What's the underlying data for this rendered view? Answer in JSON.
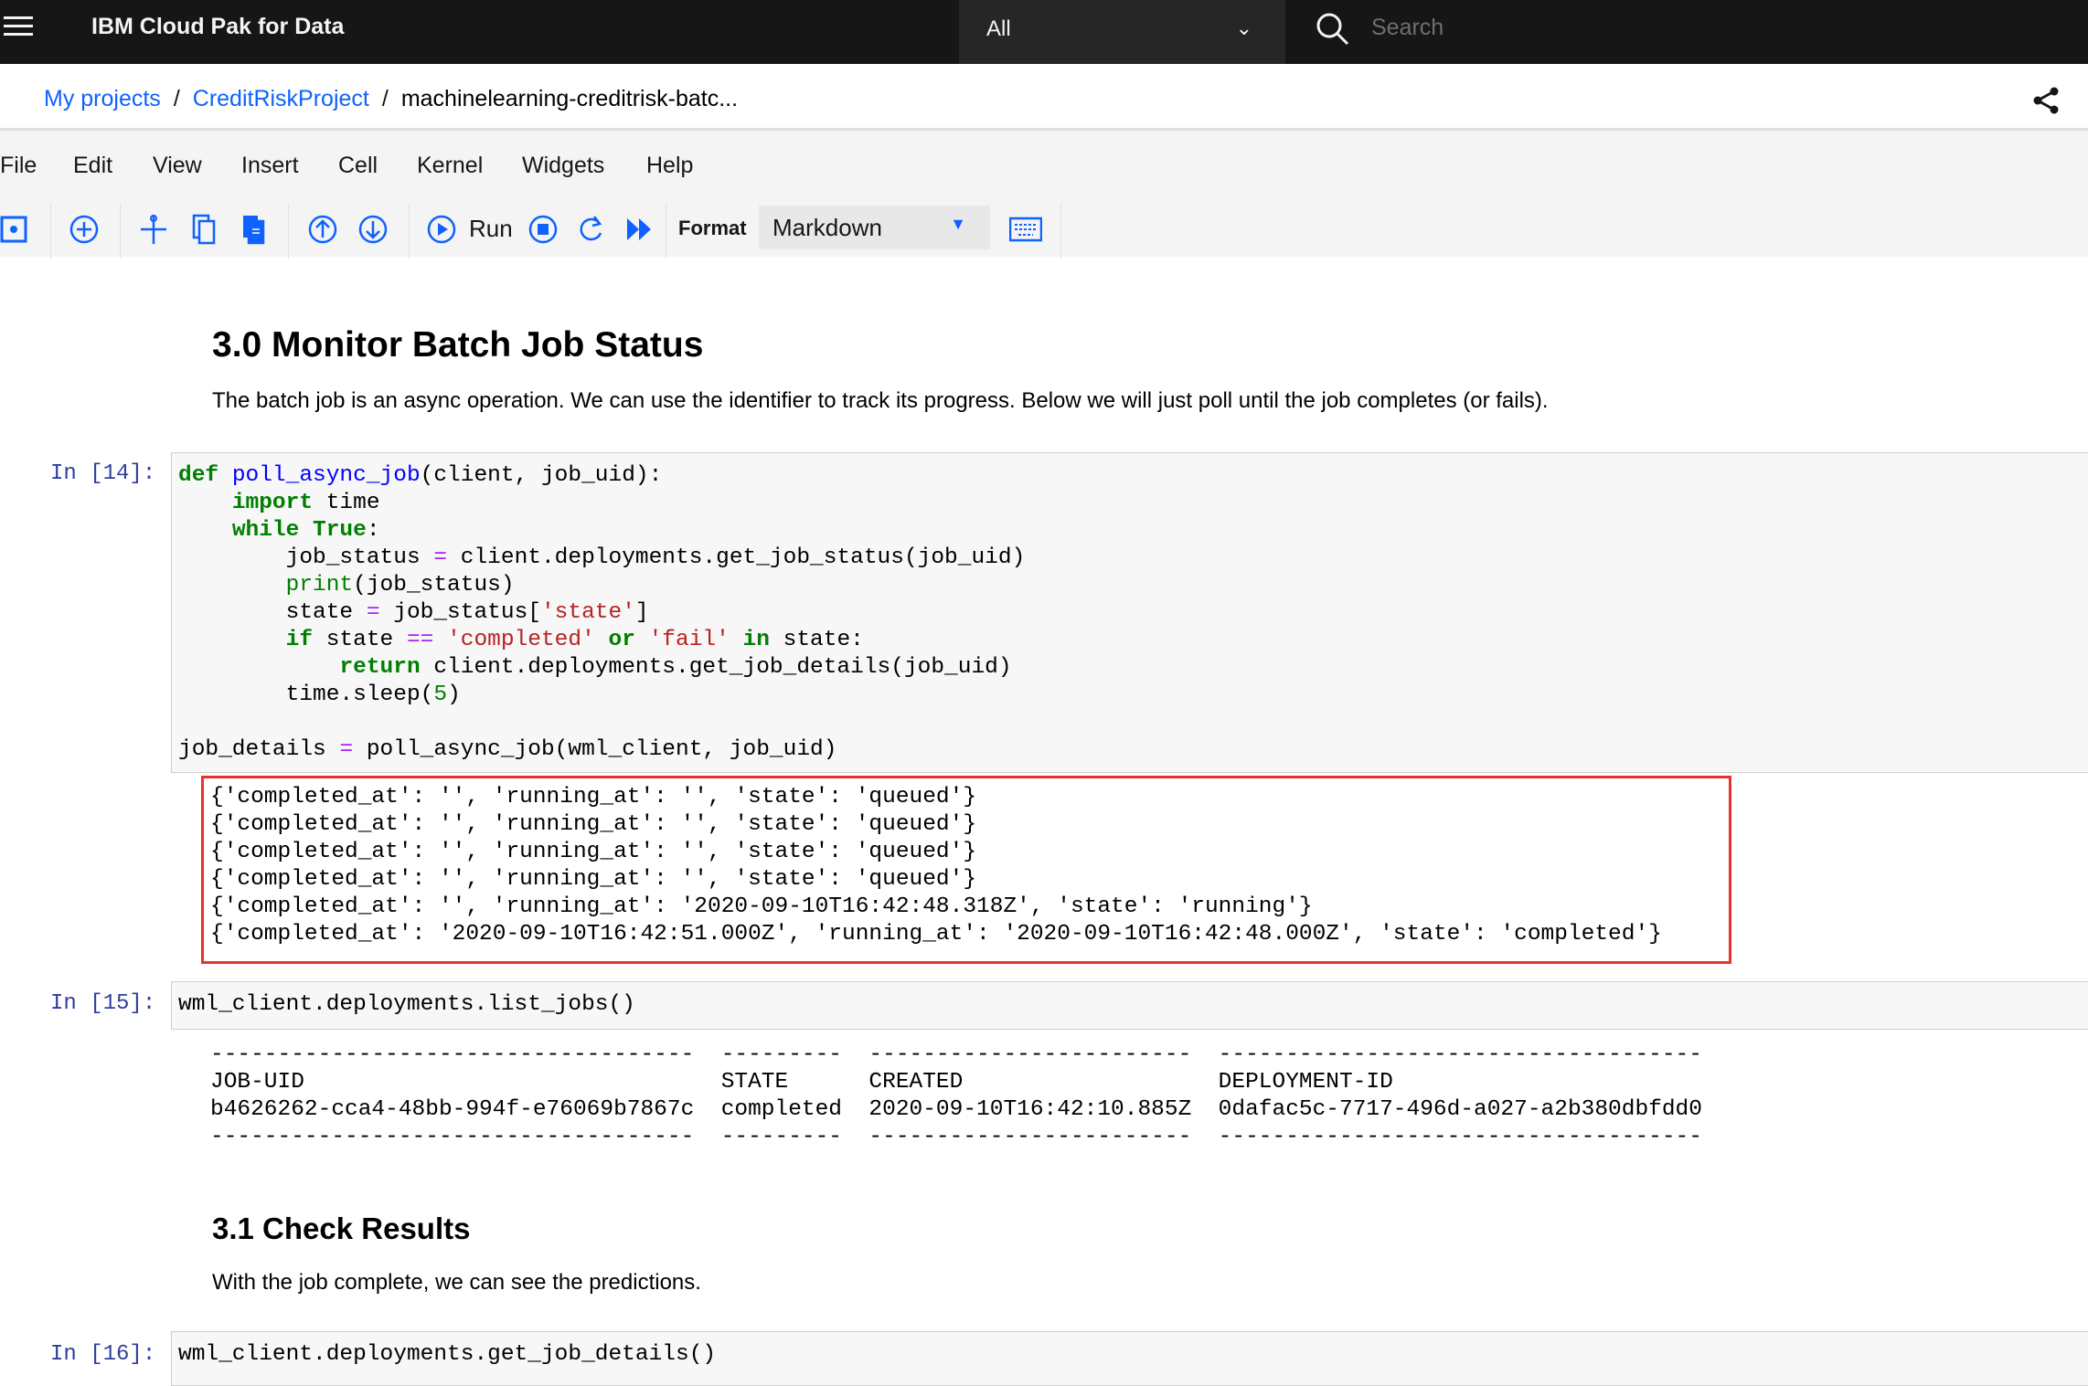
{
  "topbar": {
    "title": "IBM Cloud Pak for Data",
    "scope": "All",
    "search_placeholder": "Search"
  },
  "breadcrumb": [
    "My projects",
    "CreditRiskProject",
    "machinelearning-creditrisk-batc..."
  ],
  "menu": [
    "File",
    "Edit",
    "View",
    "Insert",
    "Cell",
    "Kernel",
    "Widgets",
    "Help"
  ],
  "toolbar": {
    "run": "Run",
    "format_label": "Format",
    "format_value": "Markdown"
  },
  "section1": {
    "title": "3.0 Monitor Batch Job Status",
    "text": "The batch job is an async operation. We can use the identifier to track its progress. Below we will just poll until the job completes (or fails)."
  },
  "cell14": {
    "prompt": "In [14]:"
  },
  "output14": [
    "{'completed_at': '', 'running_at': '', 'state': 'queued'}",
    "{'completed_at': '', 'running_at': '', 'state': 'queued'}",
    "{'completed_at': '', 'running_at': '', 'state': 'queued'}",
    "{'completed_at': '', 'running_at': '', 'state': 'queued'}",
    "{'completed_at': '', 'running_at': '2020-09-10T16:42:48.318Z', 'state': 'running'}",
    "{'completed_at': '2020-09-10T16:42:51.000Z', 'running_at': '2020-09-10T16:42:48.000Z', 'state': 'completed'}"
  ],
  "cell15": {
    "prompt": "In [15]:",
    "code": "wml_client.deployments.list_jobs()"
  },
  "output15": [
    "------------------------------------  ---------  ------------------------  ------------------------------------",
    "JOB-UID                               STATE      CREATED                   DEPLOYMENT-ID",
    "b4626262-cca4-48bb-994f-e76069b7867c  completed  2020-09-10T16:42:10.885Z  0dafac5c-7717-496d-a027-a2b380dbfdd0",
    "------------------------------------  ---------  ------------------------  ------------------------------------"
  ],
  "section2": {
    "title": "3.1 Check Results",
    "text": "With the job complete, we can see the predictions."
  },
  "cell16": {
    "prompt": "In [16]:",
    "code": "wml_client.deployments.get_job_details()"
  },
  "colors": {
    "accent": "#0f62fe",
    "topbar": "#161616",
    "highlight": "#e8322b"
  }
}
